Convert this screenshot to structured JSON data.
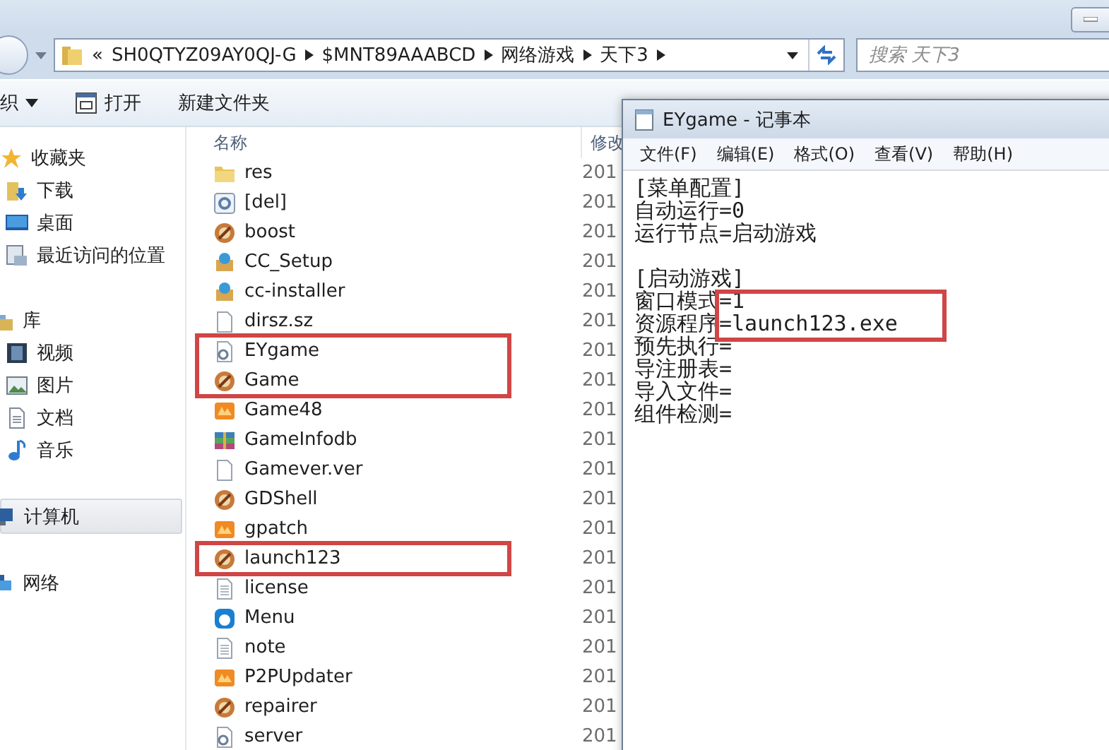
{
  "explorer": {
    "address": {
      "crumbs": [
        "SH0QTYZ09AY0QJ-G",
        "$MNT89AAABCD",
        "网络游戏",
        "天下3"
      ],
      "overflow": "«"
    },
    "search": {
      "placeholder": "搜索 天下3"
    },
    "toolbar": [
      {
        "kind": "menu",
        "label": "织"
      },
      {
        "kind": "open",
        "label": "打开"
      },
      {
        "kind": "plain",
        "label": "新建文件夹"
      }
    ],
    "sidebar": [
      {
        "label": "收藏夹",
        "kind": "star",
        "selected": false,
        "children": [
          {
            "label": "下载",
            "kind": "download",
            "selected": false
          },
          {
            "label": "桌面",
            "kind": "desktop",
            "selected": false
          },
          {
            "label": "最近访问的位置",
            "kind": "recent",
            "selected": false
          }
        ]
      },
      {
        "label": "库",
        "kind": "library",
        "selected": false,
        "children": [
          {
            "label": "视频",
            "kind": "video",
            "selected": false
          },
          {
            "label": "图片",
            "kind": "picture",
            "selected": false
          },
          {
            "label": "文档",
            "kind": "document",
            "selected": false
          },
          {
            "label": "音乐",
            "kind": "music",
            "selected": false
          }
        ]
      },
      {
        "label": "计算机",
        "kind": "computer",
        "selected": true
      },
      {
        "label": "网络",
        "kind": "network",
        "selected": false
      }
    ],
    "columns": [
      "名称",
      "修改"
    ],
    "files": [
      {
        "name": "res",
        "date": "201",
        "kind": "folder",
        "marked": false
      },
      {
        "name": "[del]",
        "date": "201",
        "kind": "config",
        "marked": false
      },
      {
        "name": "boost",
        "date": "201",
        "kind": "game",
        "marked": false
      },
      {
        "name": "CC_Setup",
        "date": "201",
        "kind": "package",
        "marked": false
      },
      {
        "name": "cc-installer",
        "date": "201",
        "kind": "package",
        "marked": false
      },
      {
        "name": "dirsz.sz",
        "date": "201",
        "kind": "blank",
        "marked": false
      },
      {
        "name": "EYgame",
        "date": "201",
        "kind": "settings",
        "marked": true
      },
      {
        "name": "Game",
        "date": "201",
        "kind": "game",
        "marked": true
      },
      {
        "name": "Game48",
        "date": "201",
        "kind": "app",
        "marked": false
      },
      {
        "name": "GameInfodb",
        "date": "201",
        "kind": "archive",
        "marked": false
      },
      {
        "name": "Gamever.ver",
        "date": "201",
        "kind": "blank",
        "marked": false
      },
      {
        "name": "GDShell",
        "date": "201",
        "kind": "game",
        "marked": false
      },
      {
        "name": "gpatch",
        "date": "201",
        "kind": "app",
        "marked": false
      },
      {
        "name": "launch123",
        "date": "201",
        "kind": "game",
        "marked": true
      },
      {
        "name": "license",
        "date": "201",
        "kind": "text",
        "marked": false
      },
      {
        "name": "Menu",
        "date": "201",
        "kind": "menu",
        "marked": false
      },
      {
        "name": "note",
        "date": "201",
        "kind": "text",
        "marked": false
      },
      {
        "name": "P2PUpdater",
        "date": "201",
        "kind": "app",
        "marked": false
      },
      {
        "name": "repairer",
        "date": "201",
        "kind": "game",
        "marked": false
      },
      {
        "name": "server",
        "date": "201",
        "kind": "settings",
        "marked": false
      }
    ]
  },
  "notepad": {
    "title": "EYgame - 记事本",
    "menu": [
      "文件(F)",
      "编辑(E)",
      "格式(O)",
      "查看(V)",
      "帮助(H)"
    ],
    "sections": [
      {
        "lines": [
          {
            "text": "[菜单配置]",
            "marked": false
          },
          {
            "text": "自动运行=0",
            "marked": false
          },
          {
            "text": "运行节点=启动游戏",
            "marked": false
          }
        ]
      },
      {
        "lines": [
          {
            "text": "[启动游戏]",
            "marked": false
          },
          {
            "text": "窗口模式=1",
            "marked": true
          },
          {
            "text": "资源程序=launch123.exe",
            "marked": true
          },
          {
            "text": "预先执行=",
            "marked": false
          },
          {
            "text": "导注册表=",
            "marked": false
          },
          {
            "text": "导入文件=",
            "marked": false
          },
          {
            "text": "组件检测=",
            "marked": false
          }
        ]
      }
    ]
  }
}
